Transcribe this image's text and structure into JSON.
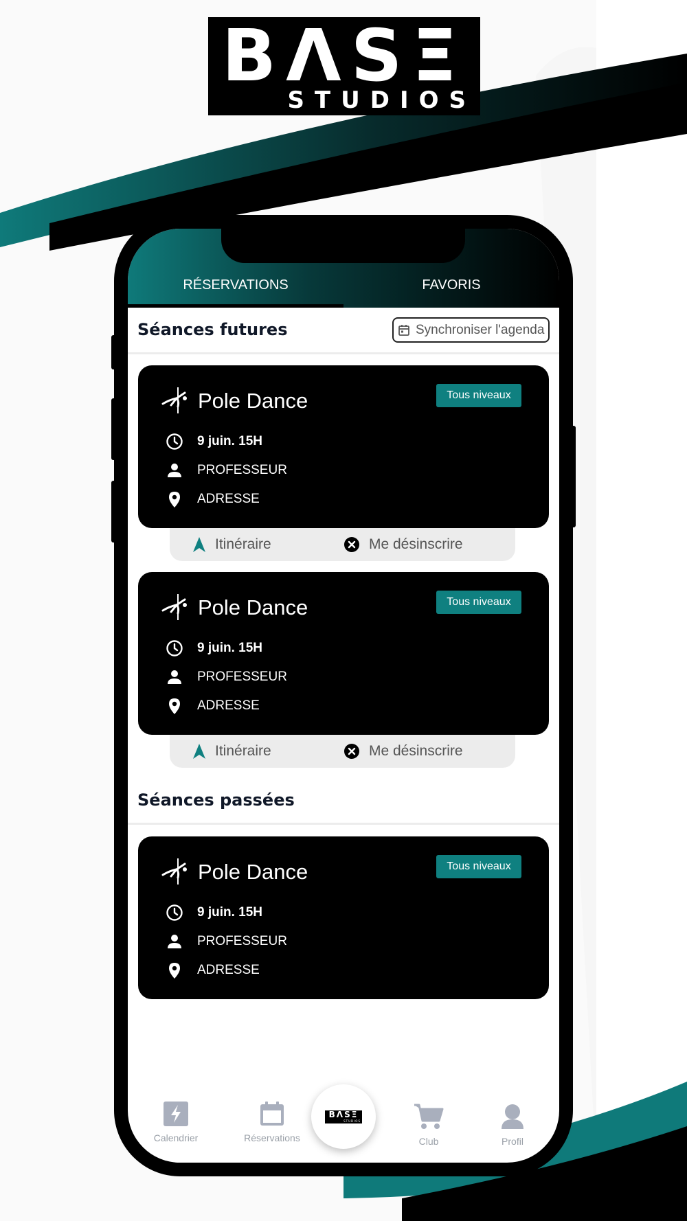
{
  "brand": {
    "logo_word": "BΛSΞ",
    "logo_sub": "STUDIOS",
    "colors": {
      "teal": "#0f8080",
      "black": "#000000",
      "light_gray": "#ececec"
    }
  },
  "tabs": [
    {
      "label": "RÉSERVATIONS",
      "active": true
    },
    {
      "label": "FAVORIS",
      "active": false
    }
  ],
  "future": {
    "title": "Séances futures",
    "sync_label": "Synchroniser l'agenda",
    "sync_icon": "calendar-icon"
  },
  "past": {
    "title": "Séances passées"
  },
  "cards": [
    {
      "title": "Pole Dance",
      "badge": "Tous niveaux",
      "date": "9 juin. 15H",
      "teacher": "PROFESSEUR",
      "address": "ADRESSE",
      "actions": {
        "route": "Itinéraire",
        "unsubscribe": "Me désinscrire"
      }
    },
    {
      "title": "Pole Dance",
      "badge": "Tous niveaux",
      "date": "9 juin. 15H",
      "teacher": "PROFESSEUR",
      "address": "ADRESSE",
      "actions": {
        "route": "Itinéraire",
        "unsubscribe": "Me désinscrire"
      }
    },
    {
      "title": "Pole Dance",
      "badge": "Tous niveaux",
      "date": "9 juin. 15H",
      "teacher": "PROFESSEUR",
      "address": "ADRESSE"
    }
  ],
  "tabbar": {
    "items": [
      {
        "label": "Calendrier",
        "icon": "lightning-icon"
      },
      {
        "label": "Réservations",
        "icon": "calendar-icon"
      },
      {
        "label": "",
        "icon": "base-logo"
      },
      {
        "label": "Club",
        "icon": "cart-icon"
      },
      {
        "label": "Profil",
        "icon": "user-icon"
      }
    ],
    "center_logo_word": "BΛSΞ",
    "center_logo_sub": "STUDIOS"
  }
}
